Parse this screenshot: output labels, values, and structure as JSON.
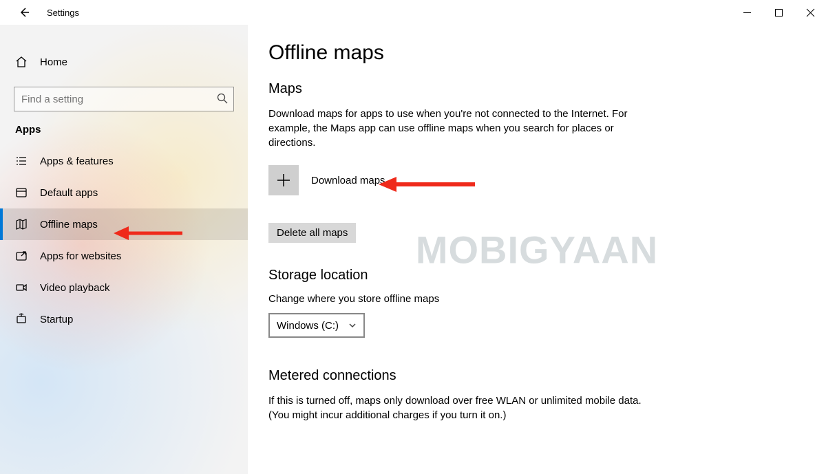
{
  "appName": "Settings",
  "sidebar": {
    "home": "Home",
    "search_placeholder": "Find a setting",
    "section": "Apps",
    "items": [
      {
        "label": "Apps & features"
      },
      {
        "label": "Default apps"
      },
      {
        "label": "Offline maps"
      },
      {
        "label": "Apps for websites"
      },
      {
        "label": "Video playback"
      },
      {
        "label": "Startup"
      }
    ]
  },
  "main": {
    "title": "Offline maps",
    "maps": {
      "heading": "Maps",
      "description": "Download maps for apps to use when you're not connected to the Internet. For example, the Maps app can use offline maps when you search for places or directions.",
      "download_label": "Download maps",
      "delete_label": "Delete all maps"
    },
    "storage": {
      "heading": "Storage location",
      "description": "Change where you store offline maps",
      "selected": "Windows (C:)"
    },
    "metered": {
      "heading": "Metered connections",
      "description": "If this is turned off, maps only download over free WLAN or unlimited mobile data. (You might incur additional charges if you turn it on.)"
    }
  },
  "watermark": "MOBIGYAAN"
}
